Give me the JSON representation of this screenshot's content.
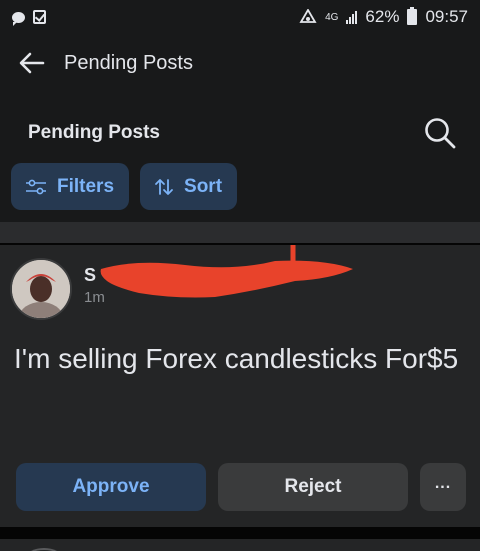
{
  "status_bar": {
    "network": "4G",
    "battery": "62%",
    "time": "09:57"
  },
  "topbar": {
    "title": "Pending Posts"
  },
  "section": {
    "title": "Pending Posts"
  },
  "chips": [
    {
      "label": "Filters",
      "icon": "sliders-icon"
    },
    {
      "label": "Sort",
      "icon": "sort-arrows-icon"
    }
  ],
  "post": {
    "author_initial": "S",
    "time": "1m",
    "text": "I'm selling Forex candlesticks For$5"
  },
  "actions": {
    "approve": "Approve",
    "reject": "Reject",
    "more": "..."
  },
  "colors": {
    "background": "#18191a",
    "card": "#242526",
    "accent": "#7cb3f7",
    "accent_bg": "#263951",
    "redaction": "#e8432b"
  }
}
